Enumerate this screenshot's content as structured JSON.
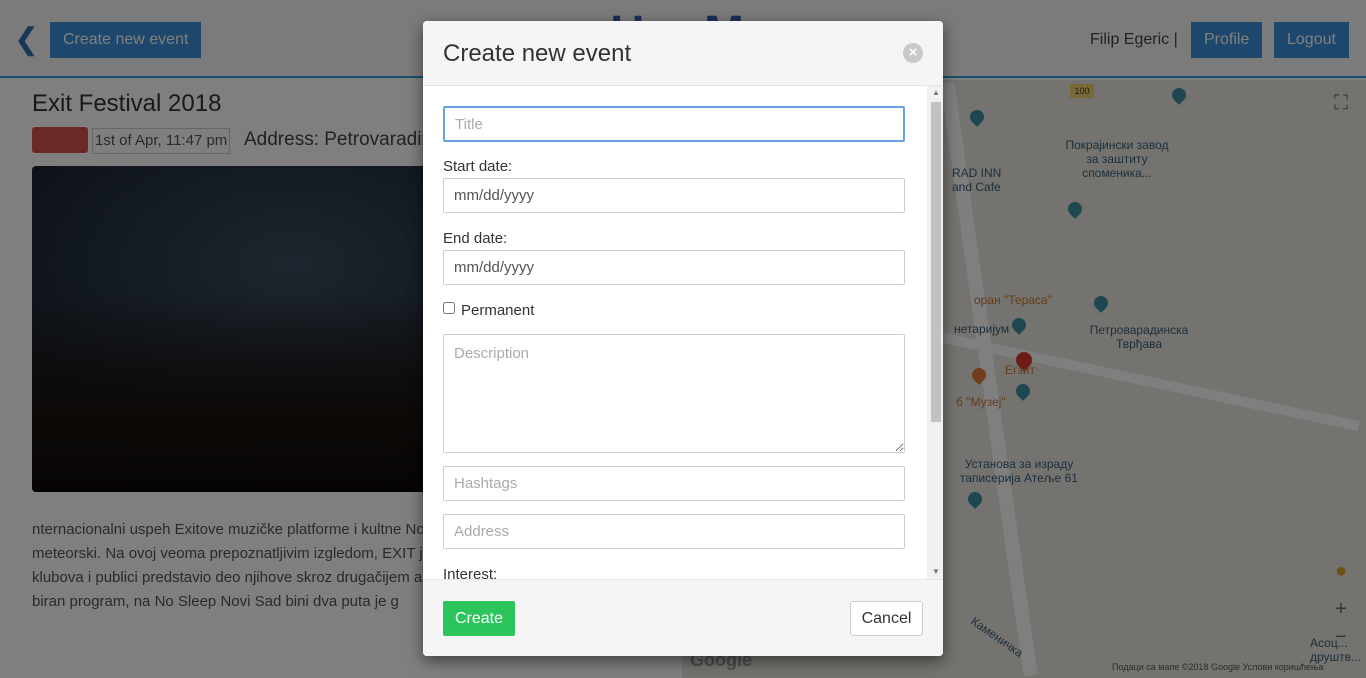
{
  "navbar": {
    "create_event_label": "Create new event",
    "brand": "HeyM",
    "user_name": "Filip Egeric |",
    "profile_label": "Profile",
    "logout_label": "Logout"
  },
  "event": {
    "title": "Exit Festival 2018",
    "date": "1st of Apr, 11:47 pm",
    "address": "Address: Petrovaradin",
    "description": "nternacionalni uspeh Exitove muzičke platforme i kultne Novi Sad može se okarakterisati kao meteorski. Na ovoj veoma prepoznatljivim izgledom, EXIT je u prethodne t najuzbudljivijih klubova i publici predstavio deo njihove skroz drugačijem ambijentu kakva je zadivljujuća Petrov biran program, na No Sleep Novi Sad bini dva puta je g"
  },
  "map": {
    "labels": [
      "Покрајински завод за заштиту споменика...",
      "RAD INN and Cafe",
      "оран \"Тераса\"",
      "нетаријум",
      "Петроварадинска Тврђава",
      "Егзит",
      "б \"Музеј\"",
      "Установа за израду таписерија Атеље 61",
      "Каменичка",
      "Асоц... друштв...",
      "100"
    ],
    "footer": "Подаци са мапе ©2018 Google   Услови коришћења",
    "google": "Google"
  },
  "modal": {
    "title": "Create new event",
    "close_icon": "×",
    "title_placeholder": "Title",
    "start_date_label": "Start date:",
    "start_date_value": "mm/dd/yyyy",
    "end_date_label": "End date:",
    "end_date_value": "mm/dd/yyyy",
    "permanent_label": "Permanent",
    "description_placeholder": "Description",
    "hashtags_placeholder": "Hashtags",
    "address_placeholder": "Address",
    "interest_label": "Interest:",
    "create_label": "Create",
    "cancel_label": "Cancel"
  },
  "colors": {
    "accent": "#3a8fd8",
    "create_button": "#2cc55b",
    "focus_border": "#66a3e0"
  }
}
